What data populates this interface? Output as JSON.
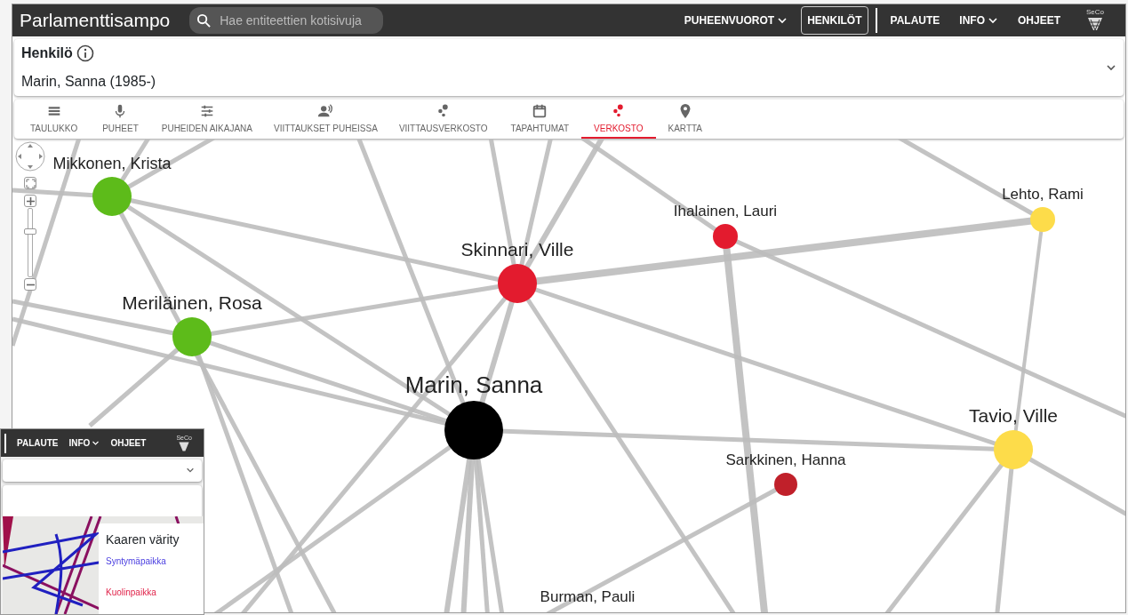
{
  "navbar": {
    "brand": "Parlamenttisampo",
    "search": {
      "placeholder": "Hae entiteettien kotisivuja"
    },
    "logo_text": "SeCo",
    "link_groups": [
      [
        {
          "label": "PUHEENVUOROT",
          "dropdown": true,
          "selected": false
        },
        {
          "label": "HENKILÖT",
          "dropdown": false,
          "selected": true
        }
      ],
      [
        {
          "label": "PALAUTE",
          "dropdown": false,
          "selected": false
        },
        {
          "label": "INFO",
          "dropdown": true,
          "selected": false
        },
        {
          "label": "OHJEET",
          "dropdown": false,
          "selected": false
        }
      ]
    ]
  },
  "entity": {
    "type_label": "Henkilö",
    "name": "Marin, Sanna (1985-)"
  },
  "tabs": [
    {
      "label": "TAULUKKO",
      "selected": false
    },
    {
      "label": "PUHEET",
      "selected": false
    },
    {
      "label": "PUHEIDEN AIKAJANA",
      "selected": false
    },
    {
      "label": "VIITTAUKSET PUHEISSA",
      "selected": false
    },
    {
      "label": "VIITTAUSVERKOSTO",
      "selected": false
    },
    {
      "label": "TAPAHTUMAT",
      "selected": false
    },
    {
      "label": "VERKOSTO",
      "selected": true
    },
    {
      "label": "KARTTA",
      "selected": false
    }
  ],
  "graph": {
    "zoom_slider": {
      "level": 0.68
    },
    "nodes": [
      {
        "label": "Mikkonen, Krista",
        "color": "#5dbb1a"
      },
      {
        "label": "Meriläinen, Rosa",
        "color": "#5dbb1a"
      },
      {
        "label": "Skinnari, Ville",
        "color": "#e31b2e"
      },
      {
        "label": "Ihalainen, Lauri",
        "color": "#e31b2e"
      },
      {
        "label": "Lehto, Rami",
        "color": "#fddc4a"
      },
      {
        "label": "Marin, Sanna",
        "color": "#000000"
      },
      {
        "label": "Tavio, Ville",
        "color": "#fddc4a"
      },
      {
        "label": "Sarkkinen, Hanna",
        "color": "#c0202a"
      },
      {
        "label": "Burman, Pauli"
      }
    ]
  },
  "inset_window": {
    "logo_text": "SeCo",
    "links": [
      {
        "label": "PALAUTE",
        "dropdown": false
      },
      {
        "label": "INFO",
        "dropdown": true
      },
      {
        "label": "OHJEET",
        "dropdown": false
      }
    ],
    "legend": {
      "title": "Kaaren värity",
      "items": [
        {
          "label": "Syntymäpaikka",
          "color": "#4a3ee0"
        },
        {
          "label": "Kuolinpaikka",
          "color": "#e0234a"
        }
      ]
    }
  }
}
